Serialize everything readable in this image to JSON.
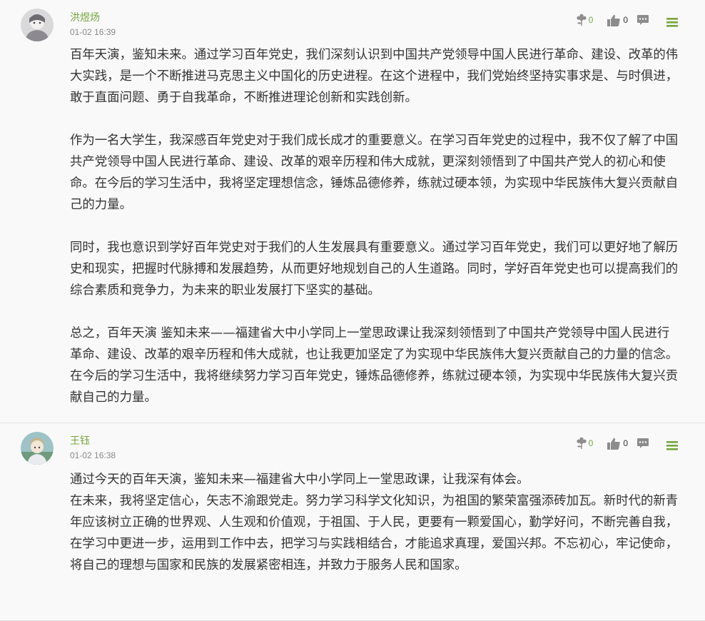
{
  "comments": [
    {
      "username": "洪煜炀",
      "time": "01-02 16:39",
      "flowers": "0",
      "likes": "0",
      "paragraphs": [
        "百年天演，鉴知未来。通过学习百年党史，我们深刻认识到中国共产党领导中国人民进行革命、建设、改革的伟大实践，是一个不断推进马克思主义中国化的历史进程。在这个进程中，我们党始终坚持实事求是、与时俱进，敢于直面问题、勇于自我革命，不断推进理论创新和实践创新。",
        "作为一名大学生，我深感百年党史对于我们成长成才的重要意义。在学习百年党史的过程中，我不仅了解了中国共产党领导中国人民进行革命、建设、改革的艰辛历程和伟大成就，更深刻领悟到了中国共产党人的初心和使命。在今后的学习生活中，我将坚定理想信念，锤炼品德修养，练就过硬本领，为实现中华民族伟大复兴贡献自己的力量。",
        "同时，我也意识到学好百年党史对于我们的人生发展具有重要意义。通过学习百年党史，我们可以更好地了解历史和现实，把握时代脉搏和发展趋势，从而更好地规划自己的人生道路。同时，学好百年党史也可以提高我们的综合素质和竞争力，为未来的职业发展打下坚实的基础。",
        "总之，百年天演 鉴知未来——福建省大中小学同上一堂思政课让我深刻领悟到了中国共产党领导中国人民进行革命、建设、改革的艰辛历程和伟大成就，也让我更加坚定了为实现中华民族伟大复兴贡献自己的力量的信念。在今后的学习生活中，我将继续努力学习百年党史，锤炼品德修养，练就过硬本领，为实现中华民族伟大复兴贡献自己的力量。"
      ]
    },
    {
      "username": "王钰",
      "time": "01-02 16:38",
      "flowers": "0",
      "likes": "0",
      "paragraphs": [
        "通过今天的百年天演，鉴知未来—福建省大中小学同上一堂思政课，让我深有体会。",
        "在未来，我将坚定信心，矢志不渝跟党走。努力学习科学文化知识，为祖国的繁荣富强添砖加瓦。新时代的新青年应该树立正确的世界观、人生观和价值观，于祖国、于人民，更要有一颗爱国心，勤学好问，不断完善自我，在学习中更进一步，运用到工作中去，把学习与实践相结合，才能追求真理，爱国兴邦。不忘初心，牢记使命，将自己的理想与国家和民族的发展紧密相连，并致力于服务人民和国家。"
      ]
    }
  ],
  "icons": {
    "flower": "flower-icon",
    "like": "thumbs-up-icon",
    "reply": "comment-icon",
    "menu": "menu-icon"
  },
  "colors": {
    "accent": "#77a53d",
    "icon_gray": "#8c8c8c",
    "text": "#333333",
    "meta": "#8a8a8a"
  }
}
